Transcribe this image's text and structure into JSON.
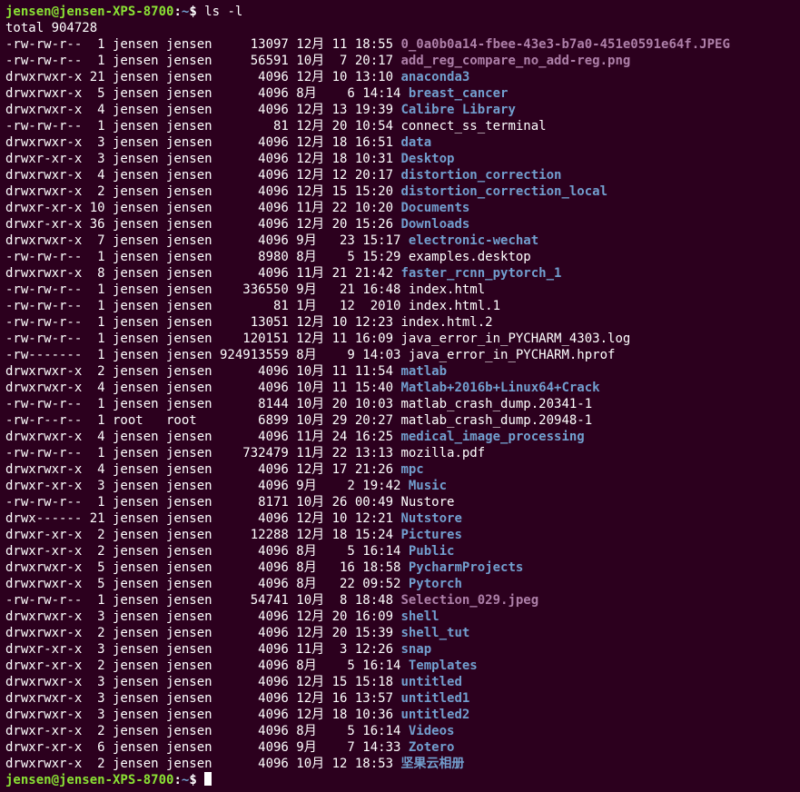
{
  "prompt": {
    "user_host": "jensen@jensen-XPS-8700",
    "sep1": ":",
    "path": "~",
    "sep2": "$ "
  },
  "command": "ls -l",
  "total_line": "total 904728",
  "entries": [
    {
      "perm": "-rw-rw-r--",
      "links": "1",
      "owner": "jensen",
      "group": "jensen",
      "size": "13097",
      "month": "12月",
      "day": "11",
      "time": "18:55",
      "name": "0_0a0b0a14-fbee-43e3-b7a0-451e0591e64f.JPEG",
      "type": "img"
    },
    {
      "perm": "-rw-rw-r--",
      "links": "1",
      "owner": "jensen",
      "group": "jensen",
      "size": "56591",
      "month": "10月",
      "day": "7",
      "time": "20:17",
      "name": "add_reg_compare_no_add-reg.png",
      "type": "img"
    },
    {
      "perm": "drwxrwxr-x",
      "links": "21",
      "owner": "jensen",
      "group": "jensen",
      "size": "4096",
      "month": "12月",
      "day": "10",
      "time": "13:10",
      "name": "anaconda3",
      "type": "dir"
    },
    {
      "perm": "drwxrwxr-x",
      "links": "5",
      "owner": "jensen",
      "group": "jensen",
      "size": "4096",
      "month": "8月",
      "day": "6",
      "time": "14:14",
      "name": "breast_cancer",
      "type": "dir"
    },
    {
      "perm": "drwxrwxr-x",
      "links": "4",
      "owner": "jensen",
      "group": "jensen",
      "size": "4096",
      "month": "12月",
      "day": "13",
      "time": "19:39",
      "name": "Calibre Library",
      "type": "dir"
    },
    {
      "perm": "-rw-rw-r--",
      "links": "1",
      "owner": "jensen",
      "group": "jensen",
      "size": "81",
      "month": "12月",
      "day": "20",
      "time": "10:54",
      "name": "connect_ss_terminal",
      "type": "file"
    },
    {
      "perm": "drwxrwxr-x",
      "links": "3",
      "owner": "jensen",
      "group": "jensen",
      "size": "4096",
      "month": "12月",
      "day": "18",
      "time": "16:51",
      "name": "data",
      "type": "dir"
    },
    {
      "perm": "drwxr-xr-x",
      "links": "3",
      "owner": "jensen",
      "group": "jensen",
      "size": "4096",
      "month": "12月",
      "day": "18",
      "time": "10:31",
      "name": "Desktop",
      "type": "dir"
    },
    {
      "perm": "drwxrwxr-x",
      "links": "4",
      "owner": "jensen",
      "group": "jensen",
      "size": "4096",
      "month": "12月",
      "day": "12",
      "time": "20:17",
      "name": "distortion_correction",
      "type": "dir"
    },
    {
      "perm": "drwxrwxr-x",
      "links": "2",
      "owner": "jensen",
      "group": "jensen",
      "size": "4096",
      "month": "12月",
      "day": "15",
      "time": "15:20",
      "name": "distortion_correction_local",
      "type": "dir"
    },
    {
      "perm": "drwxr-xr-x",
      "links": "10",
      "owner": "jensen",
      "group": "jensen",
      "size": "4096",
      "month": "11月",
      "day": "22",
      "time": "10:20",
      "name": "Documents",
      "type": "dir"
    },
    {
      "perm": "drwxr-xr-x",
      "links": "36",
      "owner": "jensen",
      "group": "jensen",
      "size": "4096",
      "month": "12月",
      "day": "20",
      "time": "15:26",
      "name": "Downloads",
      "type": "dir"
    },
    {
      "perm": "drwxrwxr-x",
      "links": "7",
      "owner": "jensen",
      "group": "jensen",
      "size": "4096",
      "month": "9月",
      "day": "23",
      "time": "15:17",
      "name": "electronic-wechat",
      "type": "dir"
    },
    {
      "perm": "-rw-rw-r--",
      "links": "1",
      "owner": "jensen",
      "group": "jensen",
      "size": "8980",
      "month": "8月",
      "day": "5",
      "time": "15:29",
      "name": "examples.desktop",
      "type": "file"
    },
    {
      "perm": "drwxrwxr-x",
      "links": "8",
      "owner": "jensen",
      "group": "jensen",
      "size": "4096",
      "month": "11月",
      "day": "21",
      "time": "21:42",
      "name": "faster_rcnn_pytorch_1",
      "type": "dir"
    },
    {
      "perm": "-rw-rw-r--",
      "links": "1",
      "owner": "jensen",
      "group": "jensen",
      "size": "336550",
      "month": "9月",
      "day": "21",
      "time": "16:48",
      "name": "index.html",
      "type": "file"
    },
    {
      "perm": "-rw-rw-r--",
      "links": "1",
      "owner": "jensen",
      "group": "jensen",
      "size": "81",
      "month": "1月",
      "day": "12",
      "time": "2010",
      "name": "index.html.1",
      "type": "file"
    },
    {
      "perm": "-rw-rw-r--",
      "links": "1",
      "owner": "jensen",
      "group": "jensen",
      "size": "13051",
      "month": "12月",
      "day": "10",
      "time": "12:23",
      "name": "index.html.2",
      "type": "file"
    },
    {
      "perm": "-rw-rw-r--",
      "links": "1",
      "owner": "jensen",
      "group": "jensen",
      "size": "120151",
      "month": "12月",
      "day": "11",
      "time": "16:09",
      "name": "java_error_in_PYCHARM_4303.log",
      "type": "file"
    },
    {
      "perm": "-rw-------",
      "links": "1",
      "owner": "jensen",
      "group": "jensen",
      "size": "924913559",
      "month": "8月",
      "day": "9",
      "time": "14:03",
      "name": "java_error_in_PYCHARM.hprof",
      "type": "file"
    },
    {
      "perm": "drwxrwxr-x",
      "links": "2",
      "owner": "jensen",
      "group": "jensen",
      "size": "4096",
      "month": "10月",
      "day": "11",
      "time": "11:54",
      "name": "matlab",
      "type": "dir"
    },
    {
      "perm": "drwxrwxr-x",
      "links": "4",
      "owner": "jensen",
      "group": "jensen",
      "size": "4096",
      "month": "10月",
      "day": "11",
      "time": "15:40",
      "name": "Matlab+2016b+Linux64+Crack",
      "type": "dir"
    },
    {
      "perm": "-rw-rw-r--",
      "links": "1",
      "owner": "jensen",
      "group": "jensen",
      "size": "8144",
      "month": "10月",
      "day": "20",
      "time": "10:03",
      "name": "matlab_crash_dump.20341-1",
      "type": "file"
    },
    {
      "perm": "-rw-r--r--",
      "links": "1",
      "owner": "root",
      "group": "root",
      "size": "6899",
      "month": "10月",
      "day": "29",
      "time": "20:27",
      "name": "matlab_crash_dump.20948-1",
      "type": "file"
    },
    {
      "perm": "drwxrwxr-x",
      "links": "4",
      "owner": "jensen",
      "group": "jensen",
      "size": "4096",
      "month": "11月",
      "day": "24",
      "time": "16:25",
      "name": "medical_image_processing",
      "type": "dir"
    },
    {
      "perm": "-rw-rw-r--",
      "links": "1",
      "owner": "jensen",
      "group": "jensen",
      "size": "732479",
      "month": "11月",
      "day": "22",
      "time": "13:13",
      "name": "mozilla.pdf",
      "type": "file"
    },
    {
      "perm": "drwxrwxr-x",
      "links": "4",
      "owner": "jensen",
      "group": "jensen",
      "size": "4096",
      "month": "12月",
      "day": "17",
      "time": "21:26",
      "name": "mpc",
      "type": "dir"
    },
    {
      "perm": "drwxr-xr-x",
      "links": "3",
      "owner": "jensen",
      "group": "jensen",
      "size": "4096",
      "month": "9月",
      "day": "2",
      "time": "19:42",
      "name": "Music",
      "type": "dir"
    },
    {
      "perm": "-rw-rw-r--",
      "links": "1",
      "owner": "jensen",
      "group": "jensen",
      "size": "8171",
      "month": "10月",
      "day": "26",
      "time": "00:49",
      "name": "Nustore",
      "type": "file"
    },
    {
      "perm": "drwx------",
      "links": "21",
      "owner": "jensen",
      "group": "jensen",
      "size": "4096",
      "month": "12月",
      "day": "10",
      "time": "12:21",
      "name": "Nutstore",
      "type": "dir"
    },
    {
      "perm": "drwxr-xr-x",
      "links": "2",
      "owner": "jensen",
      "group": "jensen",
      "size": "12288",
      "month": "12月",
      "day": "18",
      "time": "15:24",
      "name": "Pictures",
      "type": "dir"
    },
    {
      "perm": "drwxr-xr-x",
      "links": "2",
      "owner": "jensen",
      "group": "jensen",
      "size": "4096",
      "month": "8月",
      "day": "5",
      "time": "16:14",
      "name": "Public",
      "type": "dir"
    },
    {
      "perm": "drwxrwxr-x",
      "links": "5",
      "owner": "jensen",
      "group": "jensen",
      "size": "4096",
      "month": "8月",
      "day": "16",
      "time": "18:58",
      "name": "PycharmProjects",
      "type": "dir"
    },
    {
      "perm": "drwxrwxr-x",
      "links": "5",
      "owner": "jensen",
      "group": "jensen",
      "size": "4096",
      "month": "8月",
      "day": "22",
      "time": "09:52",
      "name": "Pytorch",
      "type": "dir"
    },
    {
      "perm": "-rw-rw-r--",
      "links": "1",
      "owner": "jensen",
      "group": "jensen",
      "size": "54741",
      "month": "10月",
      "day": "8",
      "time": "18:48",
      "name": "Selection_029.jpeg",
      "type": "img"
    },
    {
      "perm": "drwxrwxr-x",
      "links": "3",
      "owner": "jensen",
      "group": "jensen",
      "size": "4096",
      "month": "12月",
      "day": "20",
      "time": "16:09",
      "name": "shell",
      "type": "dir"
    },
    {
      "perm": "drwxrwxr-x",
      "links": "2",
      "owner": "jensen",
      "group": "jensen",
      "size": "4096",
      "month": "12月",
      "day": "20",
      "time": "15:39",
      "name": "shell_tut",
      "type": "dir"
    },
    {
      "perm": "drwxr-xr-x",
      "links": "3",
      "owner": "jensen",
      "group": "jensen",
      "size": "4096",
      "month": "11月",
      "day": "3",
      "time": "12:26",
      "name": "snap",
      "type": "dir"
    },
    {
      "perm": "drwxr-xr-x",
      "links": "2",
      "owner": "jensen",
      "group": "jensen",
      "size": "4096",
      "month": "8月",
      "day": "5",
      "time": "16:14",
      "name": "Templates",
      "type": "dir"
    },
    {
      "perm": "drwxrwxr-x",
      "links": "3",
      "owner": "jensen",
      "group": "jensen",
      "size": "4096",
      "month": "12月",
      "day": "15",
      "time": "15:18",
      "name": "untitled",
      "type": "dir"
    },
    {
      "perm": "drwxrwxr-x",
      "links": "3",
      "owner": "jensen",
      "group": "jensen",
      "size": "4096",
      "month": "12月",
      "day": "16",
      "time": "13:57",
      "name": "untitled1",
      "type": "dir"
    },
    {
      "perm": "drwxrwxr-x",
      "links": "3",
      "owner": "jensen",
      "group": "jensen",
      "size": "4096",
      "month": "12月",
      "day": "18",
      "time": "10:36",
      "name": "untitled2",
      "type": "dir"
    },
    {
      "perm": "drwxr-xr-x",
      "links": "2",
      "owner": "jensen",
      "group": "jensen",
      "size": "4096",
      "month": "8月",
      "day": "5",
      "time": "16:14",
      "name": "Videos",
      "type": "dir"
    },
    {
      "perm": "drwxr-xr-x",
      "links": "6",
      "owner": "jensen",
      "group": "jensen",
      "size": "4096",
      "month": "9月",
      "day": "7",
      "time": "14:33",
      "name": "Zotero",
      "type": "dir"
    },
    {
      "perm": "drwxrwxr-x",
      "links": "2",
      "owner": "jensen",
      "group": "jensen",
      "size": "4096",
      "month": "10月",
      "day": "12",
      "time": "18:53",
      "name": "坚果云相册",
      "type": "dir"
    }
  ]
}
